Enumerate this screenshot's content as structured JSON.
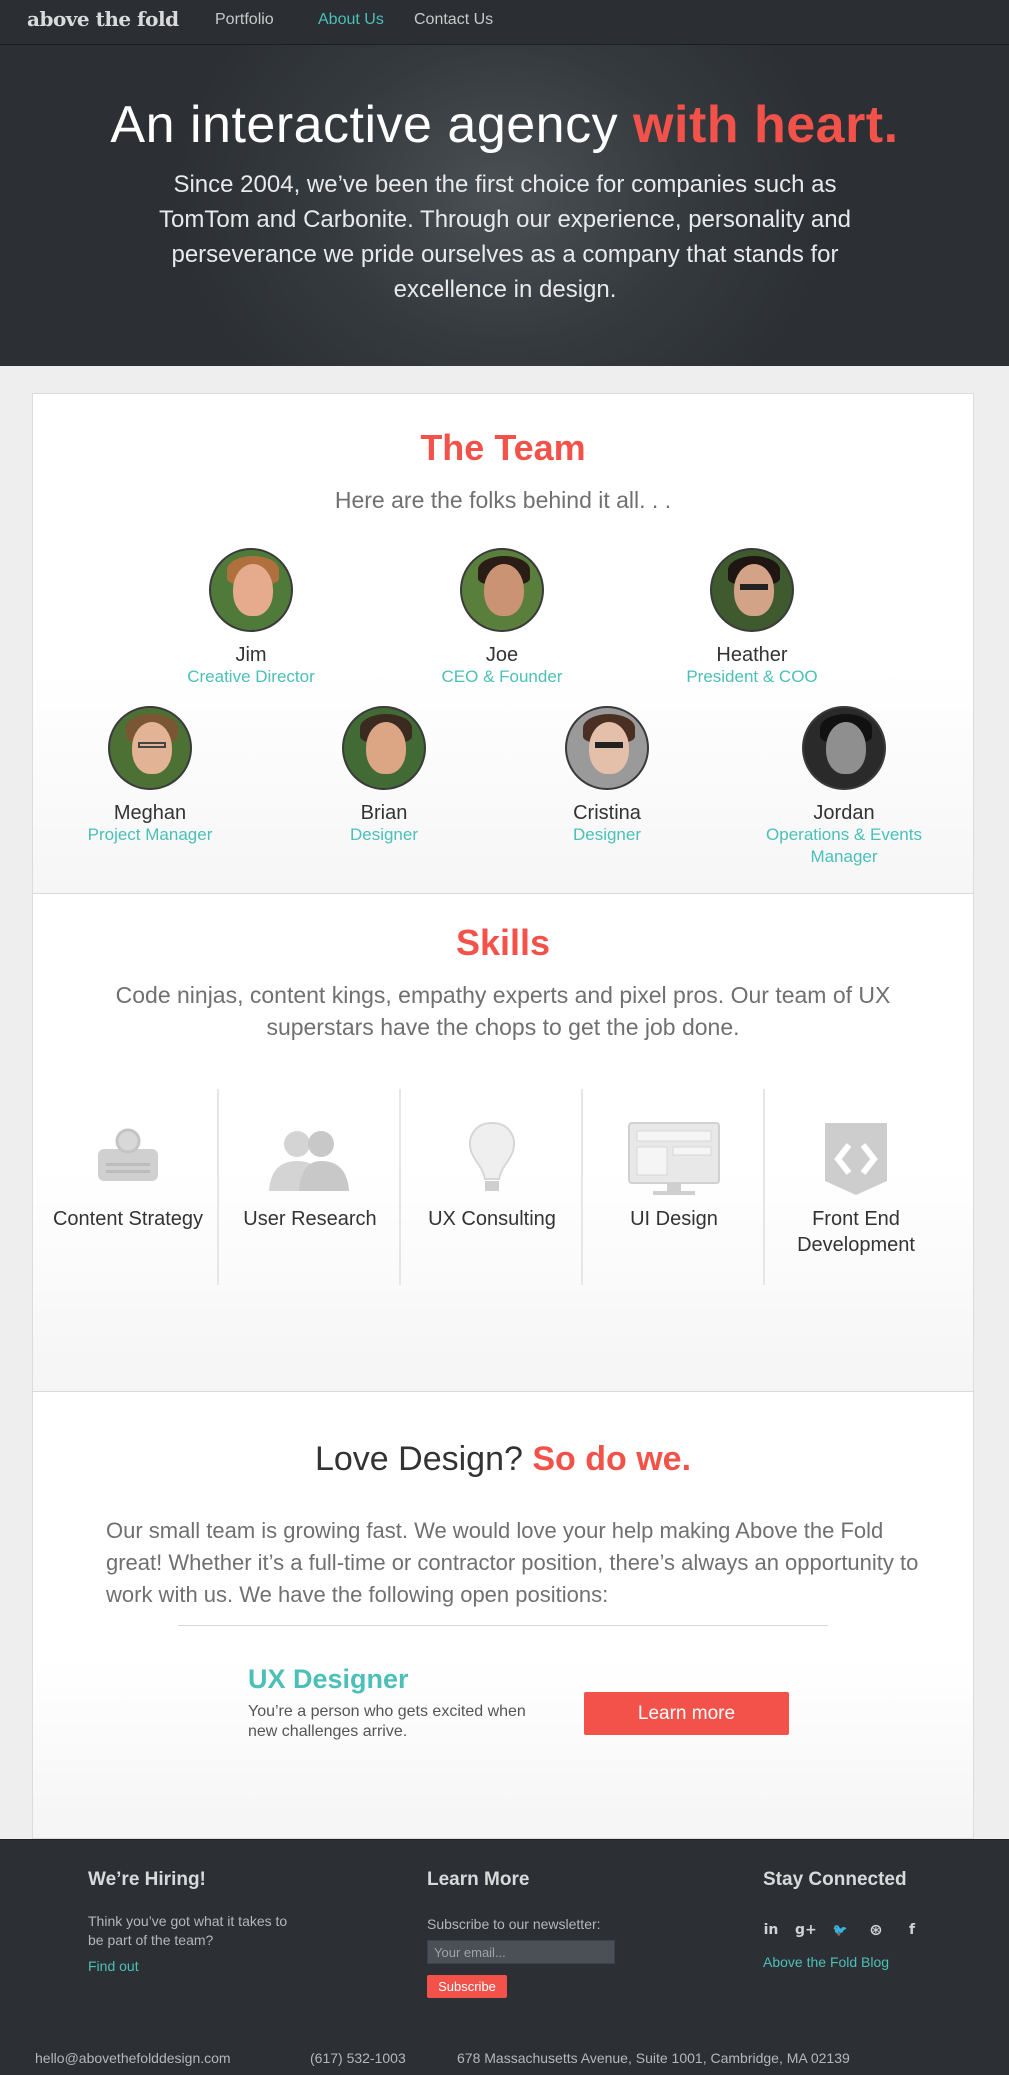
{
  "nav": {
    "logo": "above the fold",
    "links": [
      "Portfolio",
      "About Us",
      "Contact Us"
    ],
    "active": "About Us"
  },
  "hero": {
    "title_plain": "An interactive agency ",
    "title_accent": "with heart.",
    "paragraph": "Since 2004, we’ve been the first choice for companies such as TomTom and Carbonite. Through our experience, personality and perseverance we pride ourselves as a company that stands for excellence in design."
  },
  "team": {
    "title": "The Team",
    "subtitle": "Here are the folks behind it all. . .",
    "members": [
      {
        "name": "Jim",
        "role": "Creative Director"
      },
      {
        "name": "Joe",
        "role": "CEO & Founder"
      },
      {
        "name": "Heather",
        "role": "President & COO"
      },
      {
        "name": "Meghan",
        "role": "Project Manager"
      },
      {
        "name": "Brian",
        "role": "Designer"
      },
      {
        "name": "Cristina",
        "role": "Designer"
      },
      {
        "name": "Jordan",
        "role": "Operations & Events Manager"
      }
    ]
  },
  "skills": {
    "title": "Skills",
    "subtitle": "Code ninjas, content kings, empathy experts and pixel pros. Our team of UX superstars have the chops to get the job done.",
    "items": [
      {
        "label": "Content Strategy",
        "icon": "typewriter-icon"
      },
      {
        "label": "User Research",
        "icon": "users-icon"
      },
      {
        "label": "UX Consulting",
        "icon": "lightbulb-icon"
      },
      {
        "label": "UI Design",
        "icon": "monitor-icon"
      },
      {
        "label": "Front End Development",
        "icon": "code-icon"
      }
    ]
  },
  "jobs": {
    "heading_plain": "Love Design? ",
    "heading_accent": "So do we.",
    "paragraph": "Our small team is growing fast. We would love your help making Above the Fold great! Whether it’s a full-time or contractor position, there’s always an opportunity to work with us. We have the following open positions:",
    "position_title": "UX Designer",
    "position_desc": "You’re a person who gets excited when new challenges arrive.",
    "learn_more": "Learn more"
  },
  "footer": {
    "hiring_title": "We’re Hiring!",
    "hiring_text": "Think you’ve got what it takes to be part of the team?",
    "hiring_link": "Find out",
    "learn_title": "Learn More",
    "newsletter_label": "Subscribe to our newsletter:",
    "email_placeholder": "Your email...",
    "subscribe": "Subscribe",
    "connect_title": "Stay Connected",
    "social": [
      {
        "glyph": "in",
        "icon": "linkedin-icon"
      },
      {
        "glyph": "g+",
        "icon": "google-plus-icon"
      },
      {
        "glyph": "🐦",
        "icon": "twitter-icon"
      },
      {
        "glyph": "⊛",
        "icon": "dribbble-icon"
      },
      {
        "glyph": "f",
        "icon": "facebook-icon"
      }
    ],
    "blog_link": "Above the Fold Blog",
    "email": "hello@abovethefolddesign.com",
    "phone": "(617) 532-1003",
    "address": "678 Massachusetts Avenue, Suite 1001, Cambridge, MA 02139"
  },
  "colors": {
    "accent": "#f2524a",
    "teal": "#4bbfb8",
    "dark": "#2c3034"
  }
}
